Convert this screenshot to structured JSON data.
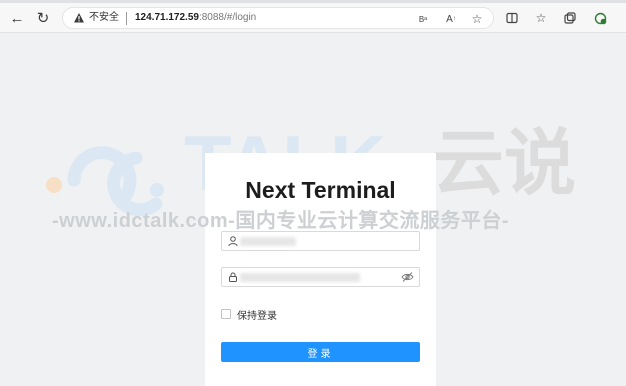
{
  "browser": {
    "address_bar": {
      "security_label": "不安全",
      "url_host": "124.71.172.59",
      "url_rest": ":8088/#/login"
    },
    "icons": [
      "back-icon",
      "refresh-icon",
      "warning-icon",
      "read-aloud-icon",
      "text-size-icon",
      "favorite-star-icon",
      "split-screen-icon",
      "favorites-icon",
      "collections-icon",
      "extension-icon"
    ]
  },
  "watermark": {
    "logo_text": "TALK",
    "logo_cn": "云说",
    "subtitle": "-www.idctalk.com-国内专业云计算交流服务平台-",
    "colors": {
      "blue": "#dbe8f4",
      "orange": "#f7dfc6",
      "gray": "#dcdcdc"
    }
  },
  "login": {
    "title": "Next Terminal",
    "remember_label": "保持登录",
    "submit_label": "登录",
    "accent_color": "#1f93ff"
  }
}
